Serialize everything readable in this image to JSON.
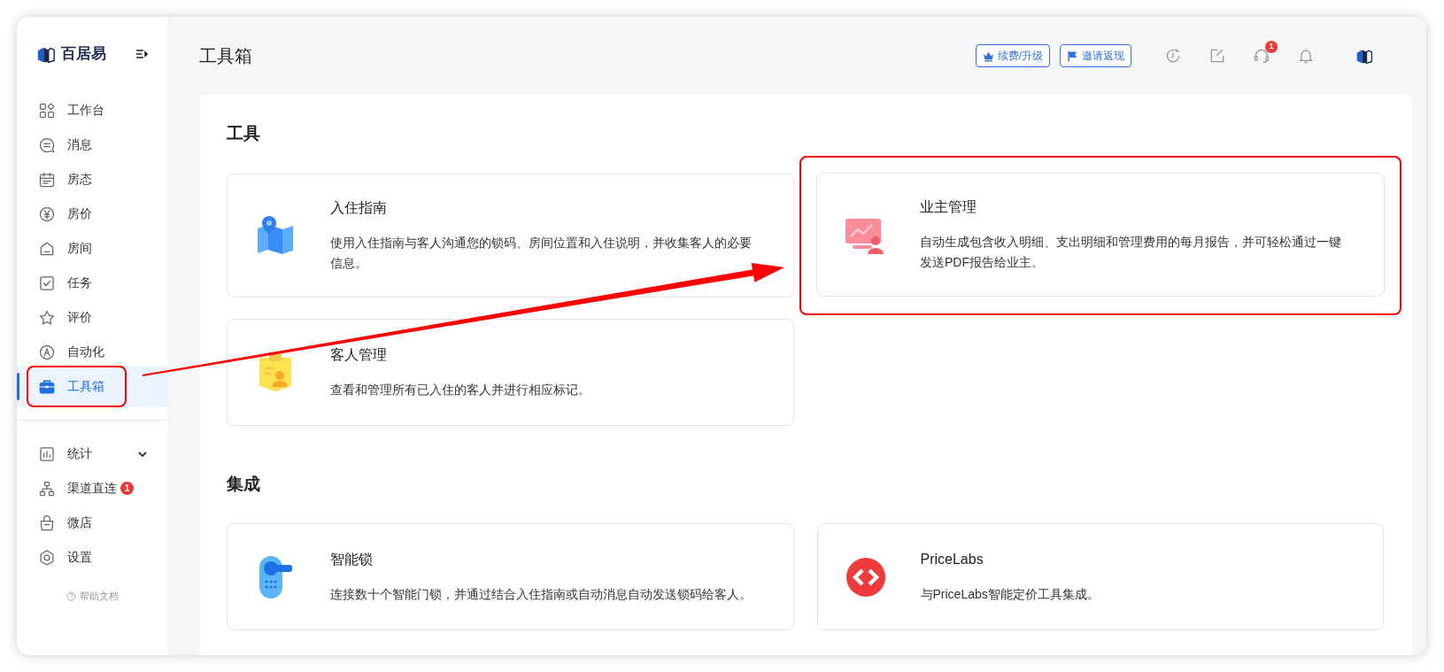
{
  "sidebar": {
    "logo_text": "百居易",
    "items": [
      {
        "kind": "grid",
        "label": "工作台",
        "selected": false
      },
      {
        "kind": "chat",
        "label": "消息",
        "selected": false
      },
      {
        "kind": "calendar",
        "label": "房态",
        "selected": false
      },
      {
        "kind": "yen",
        "label": "房价",
        "selected": false
      },
      {
        "kind": "house",
        "label": "房间",
        "selected": false
      },
      {
        "kind": "check",
        "label": "任务",
        "selected": false
      },
      {
        "kind": "star",
        "label": "评价",
        "selected": false
      },
      {
        "kind": "auto",
        "label": "自动化",
        "selected": false
      },
      {
        "kind": "toolbox",
        "label": "工具箱",
        "selected": true,
        "highlighted": true
      }
    ],
    "items_2": [
      {
        "kind": "chart",
        "label": "统计",
        "selected": false,
        "expanded": false
      },
      {
        "kind": "network",
        "label": "渠道直连",
        "selected": false,
        "badge": "1"
      },
      {
        "kind": "bag",
        "label": "微店",
        "selected": false
      },
      {
        "kind": "gear",
        "label": "设置",
        "selected": false
      }
    ],
    "help_link": "帮助文档"
  },
  "header": {
    "title": "工具箱",
    "buttons": [
      {
        "kind": "crown",
        "label": "续费/升级"
      },
      {
        "kind": "flag",
        "label": "邀请返现"
      }
    ],
    "icons": [
      {
        "kind": "history"
      },
      {
        "kind": "edit"
      },
      {
        "kind": "support",
        "badge": "1"
      },
      {
        "kind": "bell"
      },
      {
        "kind": "logo"
      }
    ]
  },
  "sections": [
    {
      "title": "工具",
      "cards": [
        {
          "kind": "map",
          "title": "入住指南",
          "description": "使用入住指南与客人沟通您的锁码、房间位置和入住说明，并收集客人的必要信息。"
        },
        {
          "kind": "monitor",
          "title": "业主管理",
          "description": "自动生成包含收入明细、支出明细和管理费用的每月报告，并可轻松通过一键发送PDF报告给业主。",
          "highlighted": true
        },
        {
          "kind": "badge",
          "title": "客人管理",
          "description": "查看和管理所有已入住的客人并进行相应标记。"
        }
      ]
    },
    {
      "title": "集成",
      "cards": [
        {
          "kind": "lock",
          "title": "智能锁",
          "description": "连接数十个智能门锁，并通过结合入住指南或自动消息自动发送锁码给客人。"
        },
        {
          "kind": "code",
          "title": "PriceLabs",
          "description": "与PriceLabs智能定价工具集成。"
        }
      ]
    }
  ]
}
